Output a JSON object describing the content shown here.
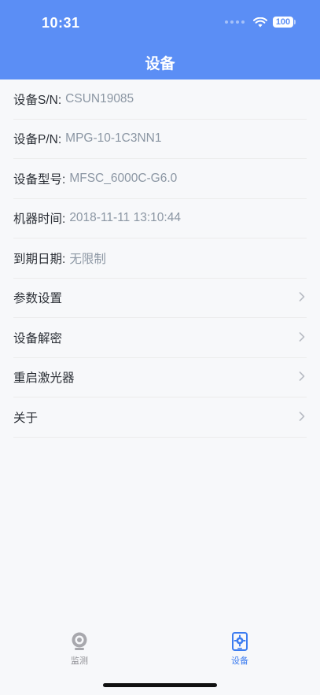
{
  "status_bar": {
    "time": "10:31",
    "battery": "100"
  },
  "header": {
    "title": "设备"
  },
  "info_rows": [
    {
      "label": "设备S/N:",
      "value": "CSUN19085"
    },
    {
      "label": "设备P/N:",
      "value": "MPG-10-1C3NN1"
    },
    {
      "label": "设备型号:",
      "value": "MFSC_6000C-G6.0"
    },
    {
      "label": "机器时间:",
      "value": "2018-11-11 13:10:44"
    },
    {
      "label": "到期日期:",
      "value": "无限制"
    }
  ],
  "menu_rows": [
    {
      "label": "参数设置"
    },
    {
      "label": "设备解密"
    },
    {
      "label": "重启激光器"
    },
    {
      "label": "关于"
    }
  ],
  "tabbar": {
    "tabs": [
      {
        "label": "监测",
        "icon": "camera-icon",
        "active": false
      },
      {
        "label": "设备",
        "icon": "device-settings-icon",
        "active": true
      }
    ]
  },
  "colors": {
    "header": "#5b8ef5",
    "active_tab": "#3c7cf0",
    "inactive_tab": "#8e8e93",
    "value_text": "#8b96a3"
  }
}
